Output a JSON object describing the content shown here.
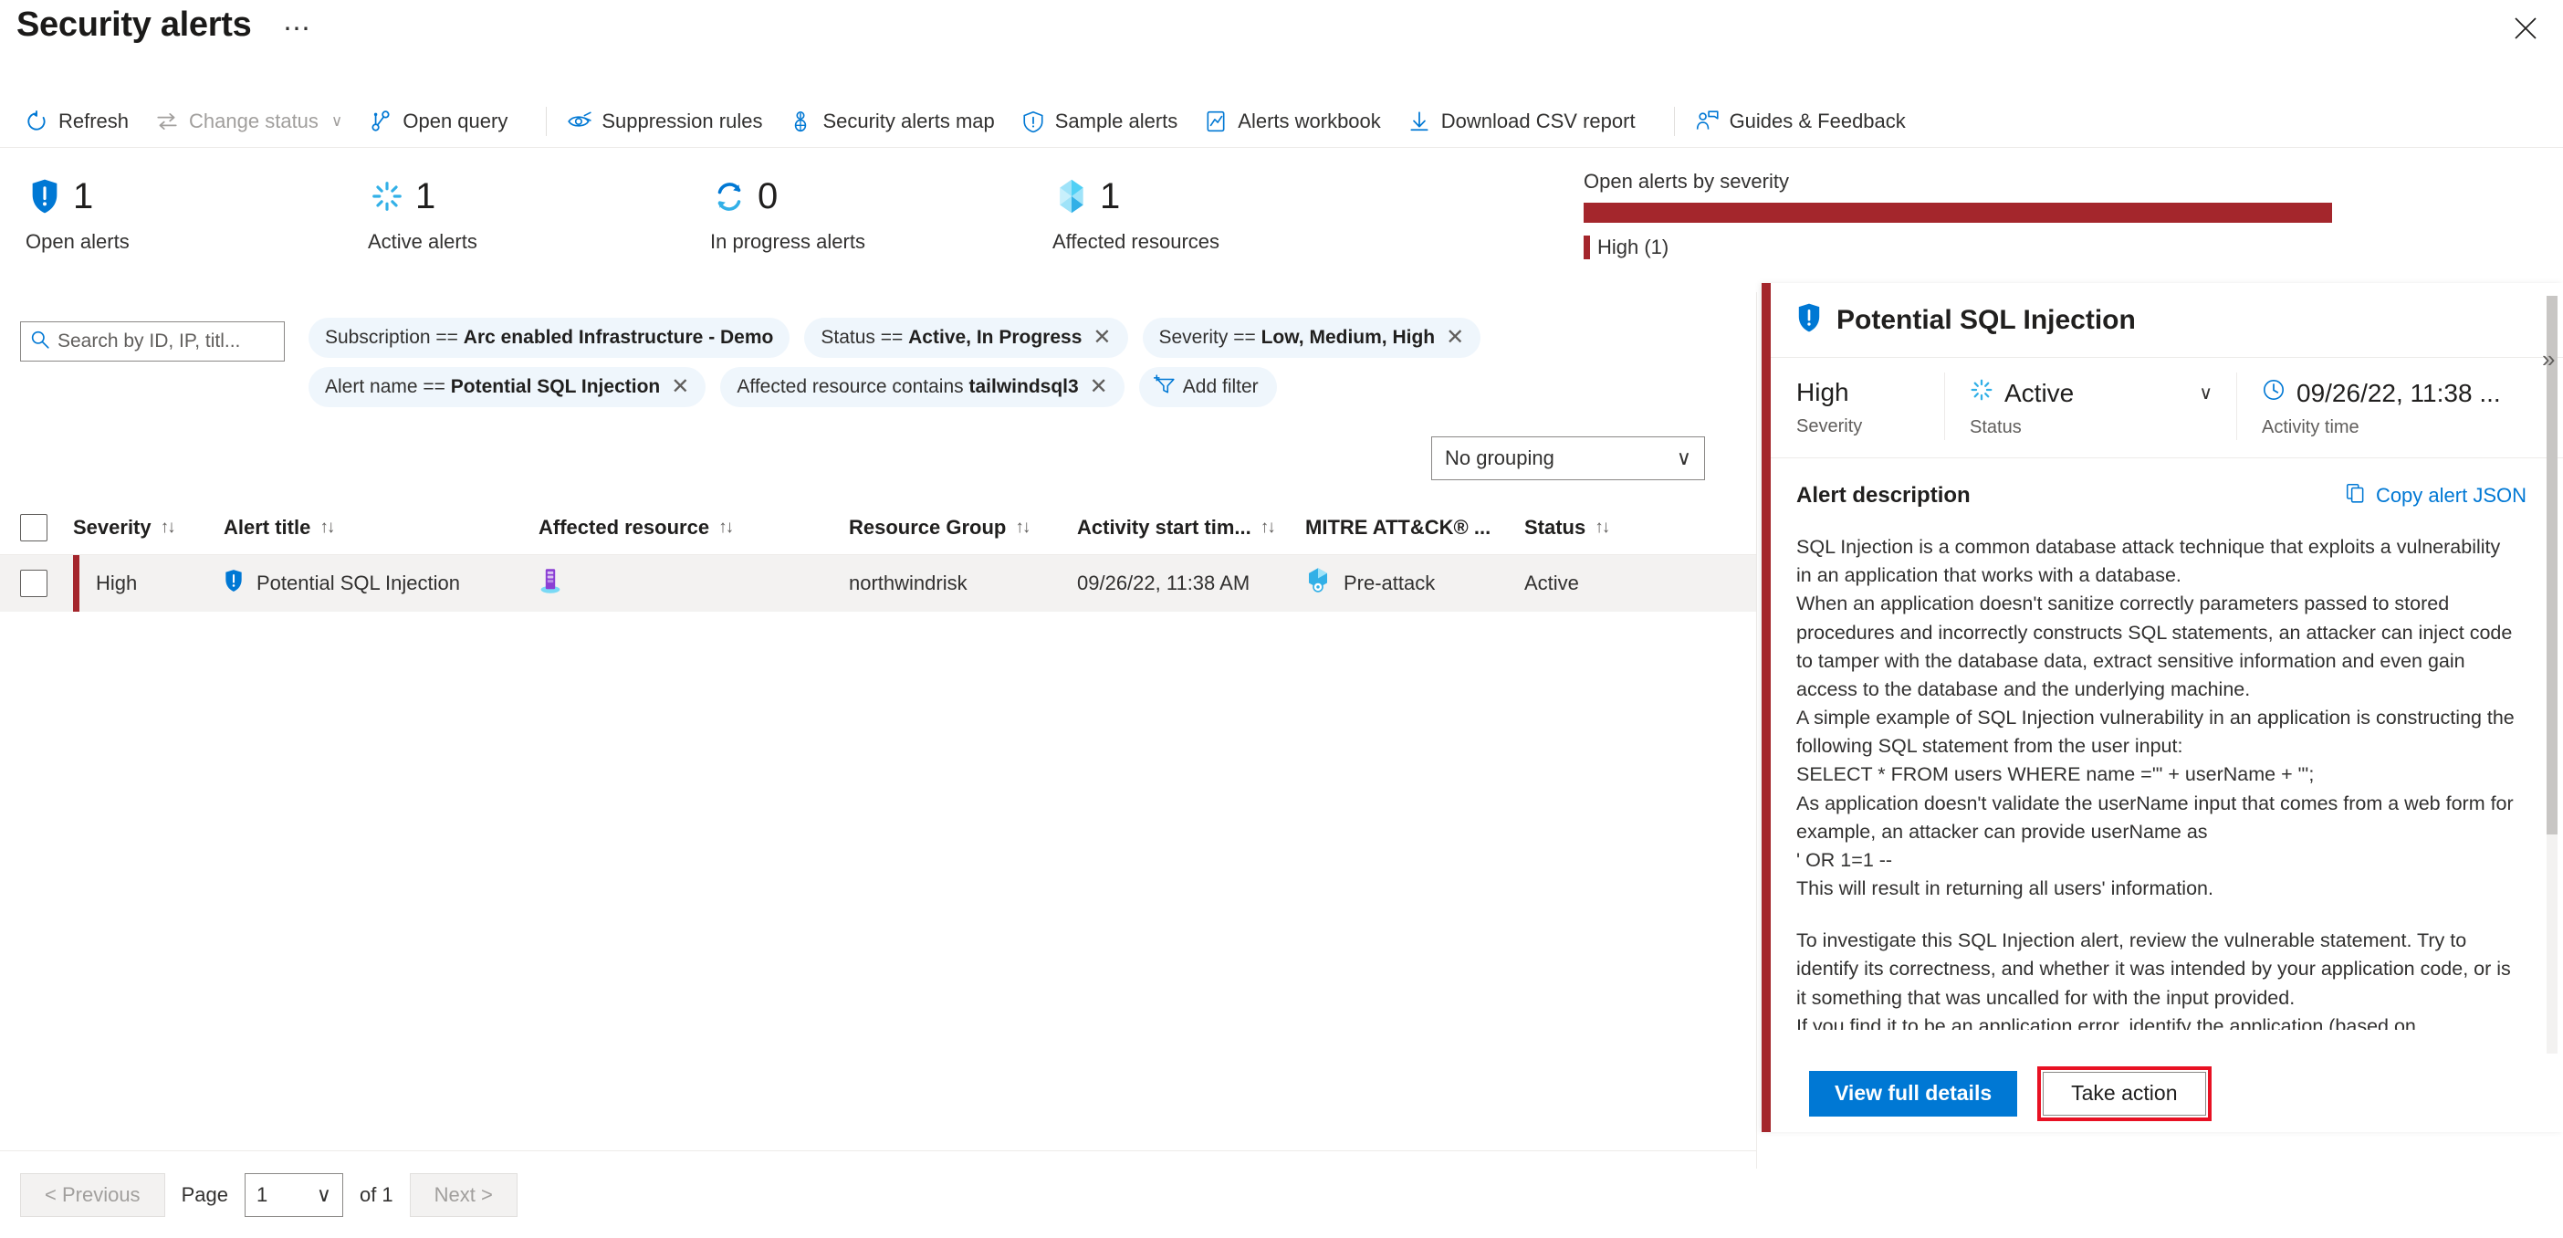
{
  "header": {
    "title": "Security alerts",
    "more_label": "⋯",
    "close_icon": "close-icon"
  },
  "toolbar": {
    "items": [
      {
        "label": "Refresh",
        "icon": "refresh-icon",
        "disabled": false
      },
      {
        "label": "Change status",
        "icon": "change-status-icon",
        "disabled": true,
        "chevron": "∨"
      },
      {
        "label": "Open query",
        "icon": "open-query-icon",
        "disabled": false
      },
      {
        "label": "Suppression rules",
        "icon": "suppression-rules-icon",
        "disabled": false
      },
      {
        "label": "Security alerts map",
        "icon": "alerts-map-icon",
        "disabled": false
      },
      {
        "label": "Sample alerts",
        "icon": "sample-alerts-icon",
        "disabled": false
      },
      {
        "label": "Alerts workbook",
        "icon": "alerts-workbook-icon",
        "disabled": false
      },
      {
        "label": "Download CSV report",
        "icon": "download-icon",
        "disabled": false
      },
      {
        "label": "Guides & Feedback",
        "icon": "guides-feedback-icon",
        "disabled": false
      }
    ]
  },
  "kpis": [
    {
      "value": "1",
      "label": "Open alerts",
      "icon": "shield-alert-icon"
    },
    {
      "value": "1",
      "label": "Active alerts",
      "icon": "active-burst-icon"
    },
    {
      "value": "0",
      "label": "In progress alerts",
      "icon": "in-progress-icon"
    },
    {
      "value": "1",
      "label": "Affected resources",
      "icon": "resource-gem-icon"
    }
  ],
  "severity_chart": {
    "title": "Open alerts by severity",
    "legend_label": "High (1)",
    "high_color": "#a4262c"
  },
  "chart_data": {
    "type": "bar",
    "title": "Open alerts by severity",
    "categories": [
      "High"
    ],
    "values": [
      1
    ],
    "colors": [
      "#a4262c"
    ],
    "legend": [
      "High (1)"
    ],
    "orientation": "horizontal-stacked",
    "total": 1,
    "xlabel": "",
    "ylabel": "",
    "grid": false,
    "legend_position": "bottom-left"
  },
  "search": {
    "placeholder": "Search by ID, IP, titl...",
    "icon": "search-icon"
  },
  "filters": {
    "row1": [
      {
        "field": "Subscription",
        "op": "==",
        "value": "Arc enabled Infrastructure - Demo",
        "close": "✕",
        "has_close": false
      },
      {
        "field": "Status",
        "op": "==",
        "value": "Active, In Progress",
        "close": "✕",
        "has_close": true
      },
      {
        "field": "Severity",
        "op": "==",
        "value": "Low, Medium, High",
        "close": "✕",
        "has_close": true
      }
    ],
    "row2": [
      {
        "field": "Alert name",
        "op": "==",
        "value": "Potential SQL Injection",
        "close": "✕",
        "has_close": true
      },
      {
        "field": "Affected resource",
        "op": "contains",
        "value": "tailwindsql3",
        "close": "✕",
        "has_close": true
      }
    ],
    "add_filter_label": "Add filter",
    "add_filter_icon": "add-filter-icon"
  },
  "grouping": {
    "value": "No grouping",
    "chevron": "∨"
  },
  "table": {
    "columns": [
      {
        "label": "Severity",
        "sort": "↑↓"
      },
      {
        "label": "Alert title",
        "sort": "↑↓"
      },
      {
        "label": "Affected resource",
        "sort": "↑↓"
      },
      {
        "label": "Resource Group",
        "sort": "↑↓"
      },
      {
        "label": "Activity start tim...",
        "sort": "↑↓"
      },
      {
        "label": "MITRE ATT&CK® ...",
        "sort": ""
      },
      {
        "label": "Status",
        "sort": "↑↓"
      }
    ],
    "rows": [
      {
        "severity": "High",
        "severity_color": "#a4262c",
        "alert_title": "Potential SQL Injection",
        "alert_icon": "shield-alert-icon",
        "affected_resource": "",
        "affected_resource_icon": "sql-database-icon",
        "resource_group": "northwindrisk",
        "activity_start_time": "09/26/22, 11:38 AM",
        "mitre": "Pre-attack",
        "mitre_icon": "mitre-preattack-icon",
        "status": "Active"
      }
    ]
  },
  "panel": {
    "title": "Potential SQL Injection",
    "title_icon": "shield-alert-icon",
    "accent_color": "#a4262c",
    "meta": {
      "severity_value": "High",
      "severity_label": "Severity",
      "status_value": "Active",
      "status_icon": "active-burst-icon",
      "status_label": "Status",
      "status_chevron": "∨",
      "time_value": "09/26/22, 11:38 ...",
      "time_icon": "clock-icon",
      "time_label": "Activity time"
    },
    "description_heading": "Alert description",
    "copy_json_label": "Copy alert JSON",
    "copy_json_icon": "copy-icon",
    "description_lines": [
      "SQL Injection is a common database attack technique that exploits a vulnerability in an application that works with a database.",
      "When an application doesn't sanitize correctly parameters passed to stored procedures and incorrectly constructs SQL statements, an attacker can inject code to tamper with the database data, extract sensitive information and even gain access to the database and the underlying machine.",
      "A simple example of SQL Injection vulnerability in an application is constructing the following SQL statement from the user input:",
      "SELECT * FROM users WHERE name ='\" + userName + \"';",
      "As application doesn't validate the userName input that comes from a web form for example, an attacker can provide userName as",
      "' OR 1=1 --",
      "This will result in returning all users' information."
    ],
    "description_lines2": [
      "To investigate this SQL Injection alert, review the vulnerable statement. Try to identify its correctness, and whether it was intended by your application code, or is it something that was uncalled for with the input provided.",
      "If you find it to be an application error, identify the application (based on"
    ],
    "actions": {
      "primary_label": "View full details",
      "secondary_label": "Take action",
      "secondary_highlight_color": "#e81123"
    },
    "collapse_icon": "collapse-panel-icon"
  },
  "footer": {
    "previous_label": "< Previous",
    "page_label": "Page",
    "page_value": "1",
    "of_label": "of 1",
    "next_label": "Next >",
    "page_chevron": "∨"
  }
}
